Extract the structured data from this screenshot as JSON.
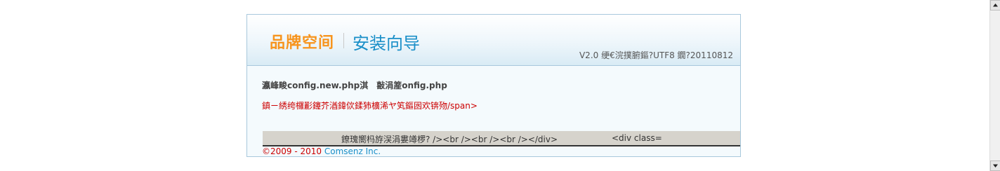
{
  "header": {
    "brand": "品牌空间",
    "title": "安装向导",
    "version": "V2.0 绠€浣撲腑鏂?UTF8 鐗?20110812"
  },
  "message": {
    "title": "瀛峰畯config.new.php淇　敼涓簅onfig.php",
    "error": "鎮ㄧ綉绔欏彲鑳芥湭鍏佽鍒犻櫎浠ヤ笂鏂囦欢锛歾/span>"
  },
  "footer": {
    "text1": "鐐瑰嚮杩斿洖涓婁竴椤? /><br /><br /><br /></div>",
    "text2": "<div class="
  },
  "copyright": {
    "year": "©2009 - 2010 ",
    "company": "Comsenz Inc."
  },
  "icons": {
    "scroll_up": "arrow-up-icon",
    "scroll_down": "arrow-down-icon"
  },
  "colors": {
    "brand": "#f7941d",
    "title": "#1a8fc8",
    "error": "#cc0000",
    "border": "#a8c8dc"
  }
}
